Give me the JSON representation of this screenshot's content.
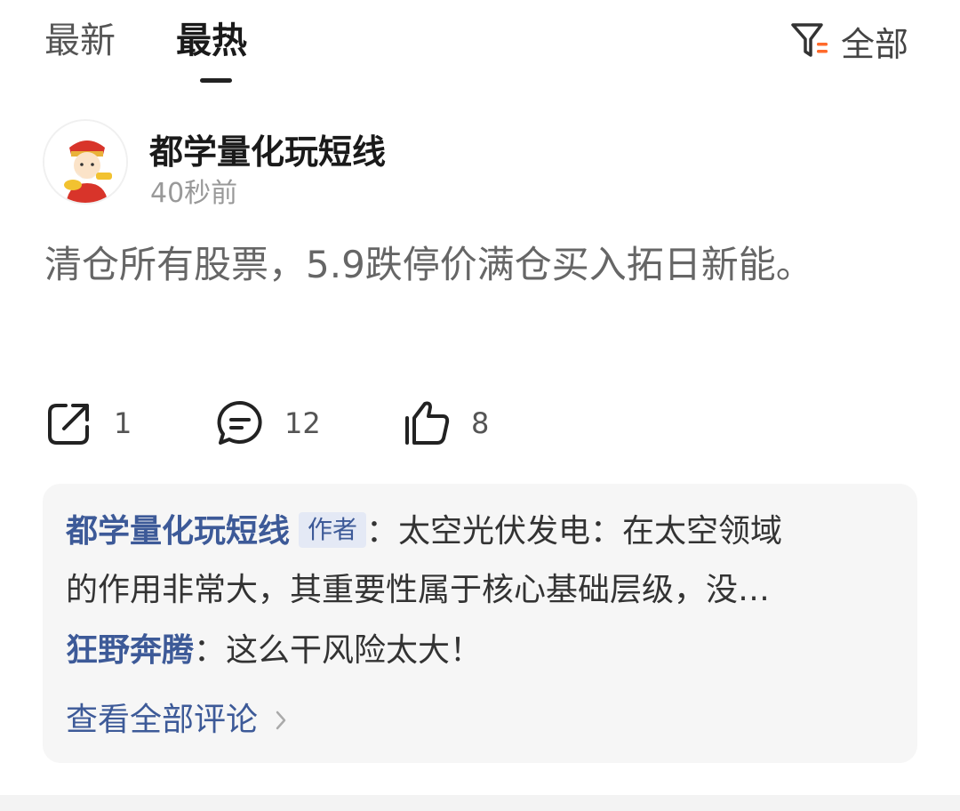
{
  "tabs": {
    "latest": "最新",
    "hot": "最热",
    "active": "hot"
  },
  "filter": {
    "icon": "filter-icon",
    "label": "全部",
    "accent": "#ff6a2b"
  },
  "post": {
    "author": "都学量化玩短线",
    "time": "40秒前",
    "content": "清仓所有股票，5.9跌停价满仓买入拓日新能。",
    "share_count": "1",
    "comment_count": "12",
    "like_count": "8"
  },
  "comments": {
    "items": [
      {
        "name": "都学量化玩短线",
        "tag": "作者",
        "text": "：太空光伏发电：在太空领域的作用非常大，其重要性属于核心基础层级，没…"
      },
      {
        "name": "狂野奔腾",
        "text": "：这么干风险太大！"
      }
    ],
    "view_all": "查看全部评论"
  },
  "colors": {
    "link": "#3d5a98",
    "body_text": "#666666",
    "panel_bg": "#f6f6f6"
  }
}
